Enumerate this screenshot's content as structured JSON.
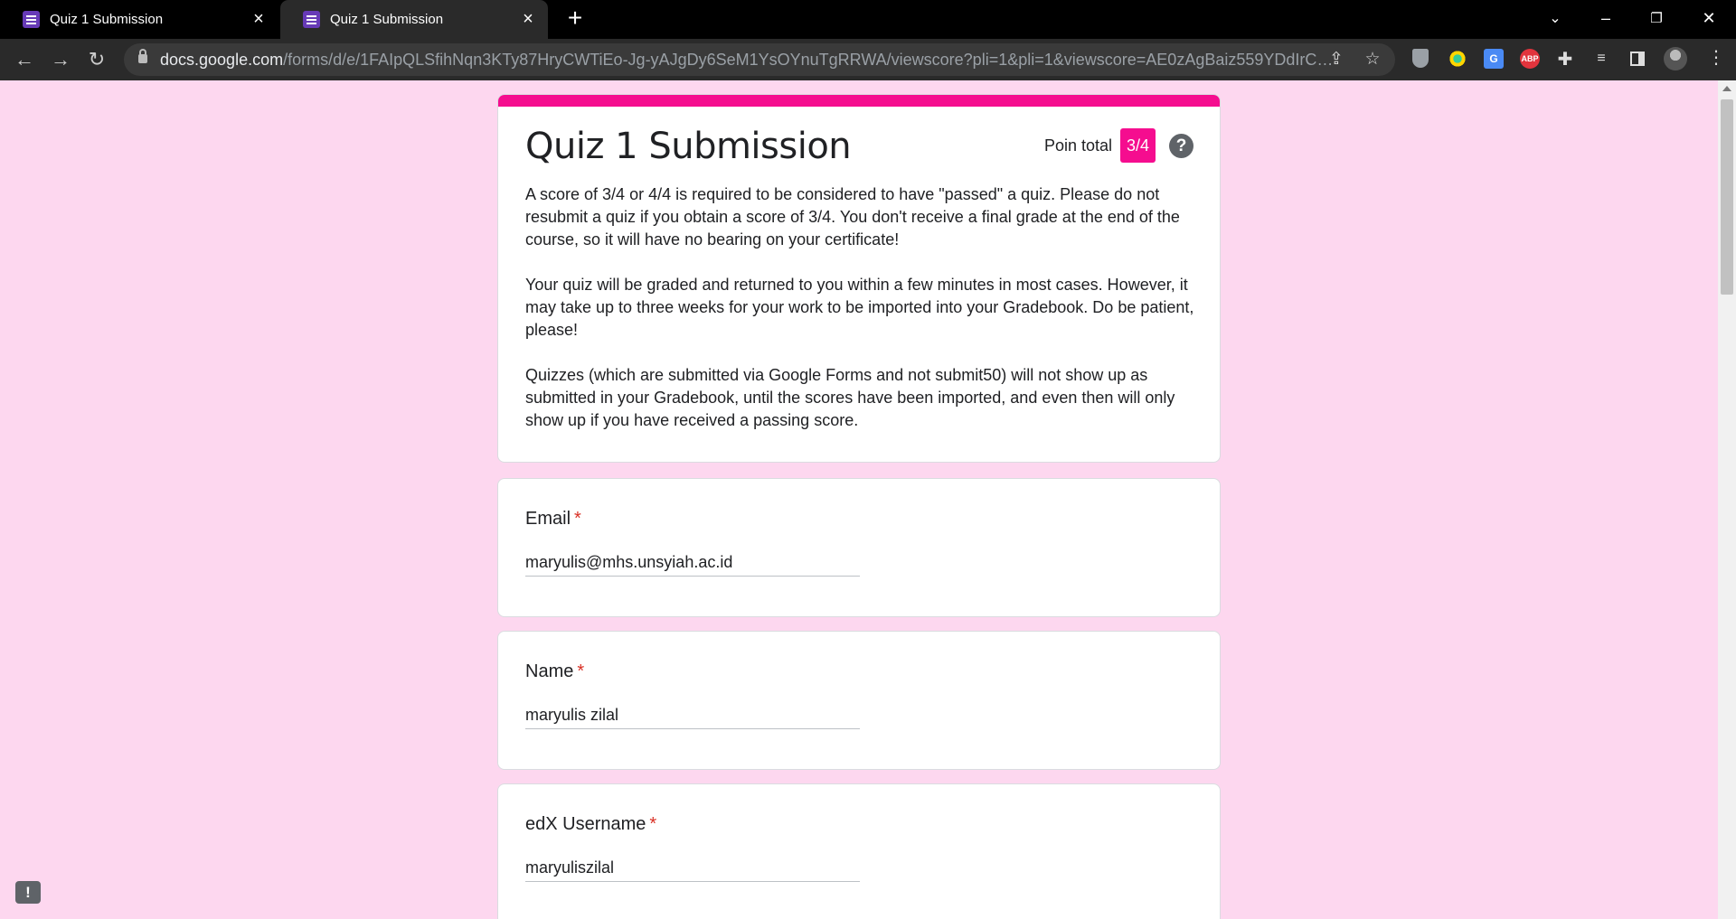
{
  "browser": {
    "tabs": [
      {
        "title": "Quiz 1 Submission",
        "active": false
      },
      {
        "title": "Quiz 1 Submission",
        "active": true
      }
    ],
    "new_tab_symbol": "+",
    "window_controls": {
      "minimize": "–",
      "restore": "❐",
      "close": "✕"
    },
    "url_host": "docs.google.com",
    "url_path": "/forms/d/e/1FAIpQLSfihNqn3KTy87HryCWTiEo-Jg-yAJgDy6SeM1YsOYnuTgRRWA/viewscore?pli=1&pli=1&viewscore=AE0zAgBaiz559YDdIrCM1yR_...",
    "extensions": [
      "shield-icon",
      "eye-extension-icon",
      "translate-icon",
      "adblock-plus-icon",
      "puzzle-icon",
      "media-control-icon",
      "sidepanel-icon"
    ],
    "abp_label": "ABP",
    "translate_label": "G"
  },
  "form": {
    "accent_color": "#f50d8f",
    "background_color": "#fdd7ef",
    "title": "Quiz 1 Submission",
    "points_label": "Poin total",
    "points_score": "3/4",
    "help_symbol": "?",
    "description": [
      "A score of 3/4 or 4/4 is required to be considered to have \"passed\" a quiz. Please do not resubmit a quiz if you obtain a score of 3/4. You don't receive a final grade at the end of the course, so it will have no bearing on your certificate!",
      "Your quiz will be graded and returned to you within a few minutes in most cases. However, it may take up to three weeks for your work to be imported into your Gradebook. Do be patient, please!",
      "Quizzes (which are submitted via Google Forms and not submit50) will not show up as submitted in your Gradebook, until the scores have been imported, and even then will only show up if you have received a passing score."
    ],
    "questions": [
      {
        "label": "Email",
        "required_mark": "*",
        "answer": "maryulis@mhs.unsyiah.ac.id"
      },
      {
        "label": "Name",
        "required_mark": "*",
        "answer": "maryulis zilal"
      },
      {
        "label": "edX Username",
        "required_mark": "*",
        "answer": "maryuliszilal"
      }
    ],
    "feedback_symbol": "!"
  }
}
